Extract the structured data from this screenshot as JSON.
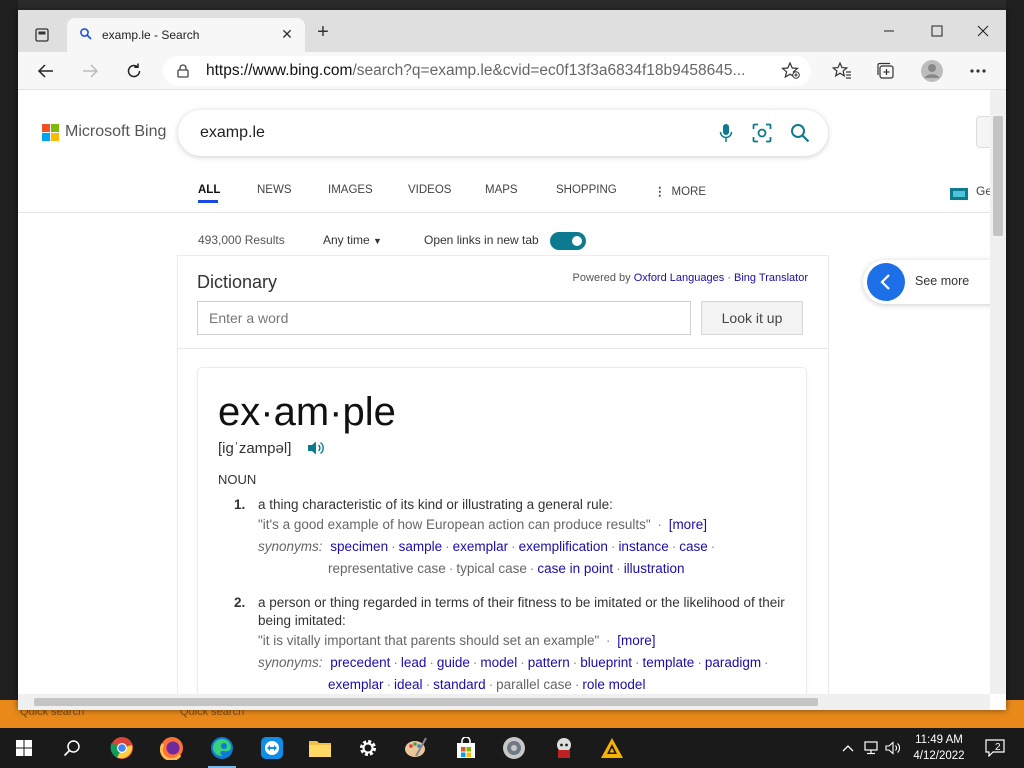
{
  "browser": {
    "tab_title": "examp.le - Search",
    "url_host": "https://www.bing.com",
    "url_rest": "/search?q=examp.le&cvid=ec0f13f3a6834f18b9458645...",
    "new_tab": "+",
    "accent": "#0e7a8f"
  },
  "bing": {
    "logo_text": "Microsoft Bing",
    "query": "examp.le",
    "scopes": [
      "ALL",
      "NEWS",
      "IMAGES",
      "VIDEOS",
      "MAPS",
      "SHOPPING",
      "MORE"
    ],
    "results_count": "493,000 Results",
    "time_filter": "Any time",
    "open_links_label": "Open links in new tab",
    "right_partial": "Ge",
    "see_more": "See more"
  },
  "dictionary": {
    "title": "Dictionary",
    "powered_by": "Powered by",
    "provider": "Oxford Languages",
    "separator": "·",
    "translator": "Bing Translator",
    "input_placeholder": "Enter a word",
    "lookup_button": "Look it up",
    "word": "ex·am·ple",
    "pronunciation": "[iɡˈzampəl]",
    "part_of_speech": "NOUN",
    "synonyms_label": "synonyms:",
    "more_label": "[more]",
    "senses": [
      {
        "num": "1.",
        "definition": "a thing characteristic of its kind or illustrating a general rule:",
        "example": "\"it's a good example of how European action can produce results\"",
        "synonyms_line1": [
          "specimen",
          "sample",
          "exemplar",
          "exemplification",
          "instance",
          "case"
        ],
        "synonyms_line2": [
          "representative case",
          "typical case",
          "case in point",
          "illustration"
        ]
      },
      {
        "num": "2.",
        "definition": "a person or thing regarded in terms of their fitness to be imitated or the likelihood of their being imitated:",
        "example": "\"it is vitally important that parents should set an example\"",
        "synonyms_line1": [
          "precedent",
          "lead",
          "guide",
          "model",
          "pattern",
          "blueprint",
          "template",
          "paradigm"
        ],
        "synonyms_line2": [
          "exemplar",
          "ideal",
          "standard",
          "parallel case",
          "role model"
        ]
      }
    ]
  },
  "desktop": {
    "quick_search": "Quick search"
  },
  "taskbar": {
    "time": "11:49 AM",
    "date": "4/12/2022",
    "notifications": "2"
  }
}
